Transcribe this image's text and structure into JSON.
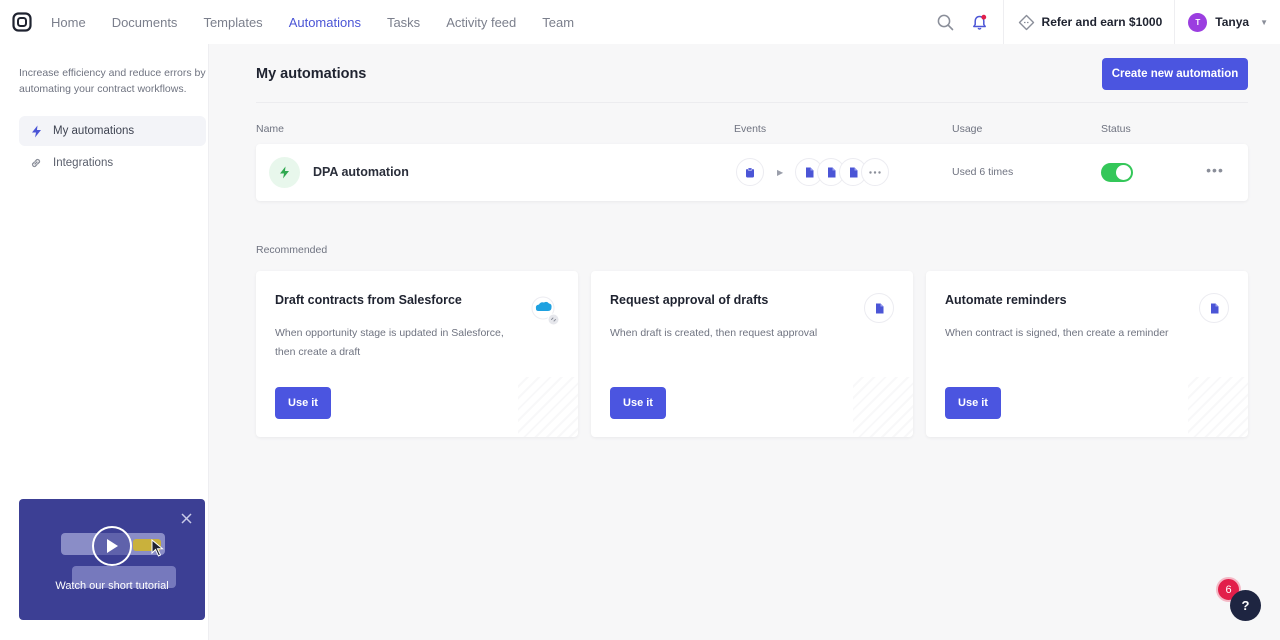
{
  "nav": {
    "items": [
      {
        "label": "Home",
        "active": false
      },
      {
        "label": "Documents",
        "active": false
      },
      {
        "label": "Templates",
        "active": false
      },
      {
        "label": "Automations",
        "active": true
      },
      {
        "label": "Tasks",
        "active": false
      },
      {
        "label": "Activity feed",
        "active": false
      },
      {
        "label": "Team",
        "active": false
      }
    ],
    "refer_label": "Refer and earn $1000",
    "user": {
      "initial": "T",
      "name": "Tanya"
    }
  },
  "sidebar": {
    "description": "Increase efficiency and reduce errors by automating your contract workflows.",
    "items": [
      {
        "label": "My automations",
        "icon": "bolt-icon",
        "active": true
      },
      {
        "label": "Integrations",
        "icon": "link-icon",
        "active": false
      }
    ],
    "tutorial_label": "Watch our short tutorial"
  },
  "main": {
    "title": "My automations",
    "create_button": "Create new automation",
    "columns": {
      "name": "Name",
      "events": "Events",
      "usage": "Usage",
      "status": "Status"
    },
    "automations": [
      {
        "name": "DPA automation",
        "usage": "Used 6 times",
        "enabled": true
      }
    ],
    "recommended_label": "Recommended",
    "recommended": [
      {
        "title": "Draft contracts from Salesforce",
        "description": "When opportunity stage is updated in Salesforce, then create a draft",
        "button": "Use it",
        "icon": "salesforce-icon"
      },
      {
        "title": "Request approval of drafts",
        "description": "When draft is created, then request approval",
        "button": "Use it",
        "icon": "document-icon"
      },
      {
        "title": "Automate reminders",
        "description": "When contract is signed, then create a reminder",
        "button": "Use it",
        "icon": "document-icon"
      }
    ]
  },
  "help": {
    "badge_count": "6",
    "label": "?"
  },
  "colors": {
    "accent": "#4b55e0",
    "active_nav": "#4b55d6",
    "toggle_on": "#34c759",
    "tutorial_bg": "#3c3f94"
  }
}
